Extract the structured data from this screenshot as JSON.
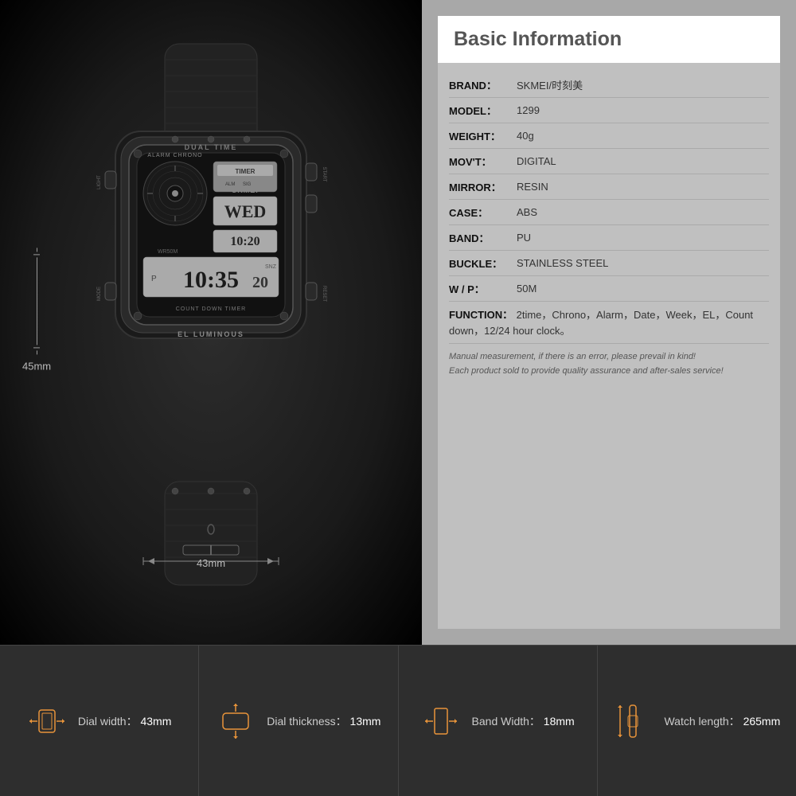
{
  "page": {
    "background": "#1a1a1a"
  },
  "info_panel": {
    "title": "Basic Information",
    "rows": [
      {
        "label": "BRAND：",
        "value": "SKMEI/时刻美"
      },
      {
        "label": "MODEL：",
        "value": "1299"
      },
      {
        "label": "WEIGHT：",
        "value": "40g"
      },
      {
        "label": "MOV'T：",
        "value": "DIGITAL"
      },
      {
        "label": "MIRROR：",
        "value": "RESIN"
      },
      {
        "label": "CASE：",
        "value": "ABS"
      },
      {
        "label": "BAND：",
        "value": "PU"
      },
      {
        "label": "BUCKLE：",
        "value": "STAINLESS STEEL"
      },
      {
        "label": "W / P：",
        "value": "50M"
      }
    ],
    "function_label": "FUNCTION：",
    "function_value": "2time，Chrono，Alarm，Date，Week，EL，Count down，12/24 hour clock。",
    "note_line1": "Manual measurement, if there is an error, please prevail in kind!",
    "note_line2": "Each product sold to provide quality assurance and after-sales service!"
  },
  "dimensions": {
    "height_label": "45mm",
    "width_label": "43mm"
  },
  "specs": [
    {
      "id": "dial-width",
      "label": "Dial width：",
      "value": "43mm",
      "icon": "dial-width-icon"
    },
    {
      "id": "dial-thickness",
      "label": "Dial thickness：",
      "value": "13mm",
      "icon": "dial-thickness-icon"
    },
    {
      "id": "band-width",
      "label": "Band Width：",
      "value": "18mm",
      "icon": "band-width-icon"
    },
    {
      "id": "watch-length",
      "label": "Watch length：",
      "value": "265mm",
      "icon": "watch-length-icon"
    }
  ]
}
